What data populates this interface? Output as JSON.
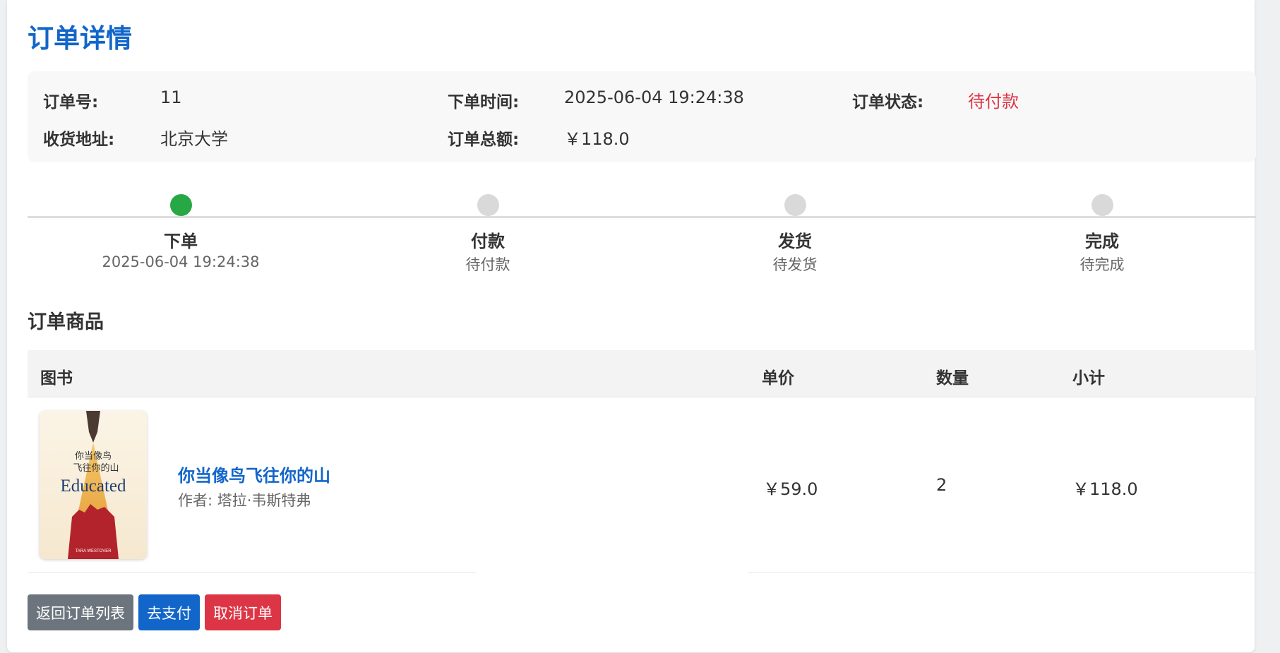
{
  "page": {
    "title": "订单详情"
  },
  "info": {
    "order_no_label": "订单号:",
    "order_no": "11",
    "time_label": "下单时间:",
    "time": "2025-06-04 19:24:38",
    "status_label": "订单状态:",
    "status": "待付款",
    "address_label": "收货地址:",
    "address": "北京大学",
    "total_label": "订单总额:",
    "total": "￥118.0"
  },
  "steps": [
    {
      "title": "下单",
      "sub": "2025-06-04 19:24:38",
      "done": true
    },
    {
      "title": "付款",
      "sub": "待付款",
      "done": false
    },
    {
      "title": "发货",
      "sub": "待发货",
      "done": false
    },
    {
      "title": "完成",
      "sub": "待完成",
      "done": false
    }
  ],
  "items_section": {
    "title": "订单商品",
    "headers": {
      "book": "图书",
      "price": "单价",
      "qty": "数量",
      "subtotal": "小计"
    },
    "rows": [
      {
        "title": "你当像鸟飞往你的山",
        "author": "作者: 塔拉·韦斯特弗",
        "price": "￥59.0",
        "qty": "2",
        "subtotal": "￥118.0",
        "cover": {
          "cn_line1": "你当像鸟",
          "cn_line2": "飞往你的山",
          "en_title": "Educated",
          "author_en": "TARA WESTOVER"
        }
      }
    ]
  },
  "actions": {
    "back": "返回订单列表",
    "pay": "去支付",
    "cancel": "取消订单"
  },
  "colors": {
    "accent": "#1266c9",
    "danger": "#dc3545",
    "success": "#28a745",
    "secondary": "#6c757d"
  }
}
